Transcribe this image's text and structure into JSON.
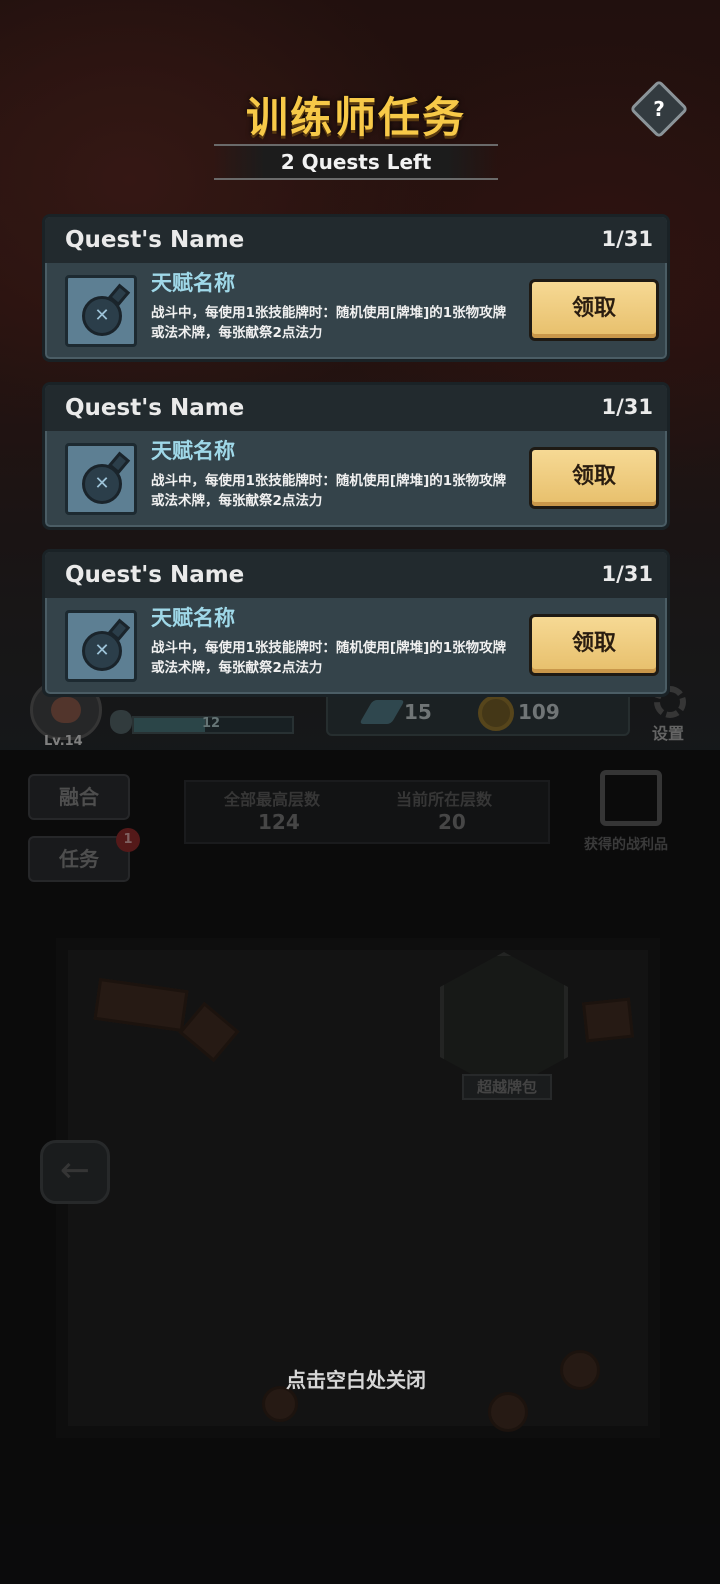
{
  "modal": {
    "title": "训练师任务",
    "subtitle": "2 Quests Left",
    "help_label": "?",
    "close_hint": "点击空白处关闭"
  },
  "quests": [
    {
      "name": "Quest's Name",
      "progress": "1/31",
      "talent_name": "天赋名称",
      "description": "战斗中，每使用1张技能牌时：随机使用[牌堆]的1张物攻牌或法术牌，每张献祭2点法力",
      "claim_label": "领取",
      "icon": "potion-bottle-icon"
    },
    {
      "name": "Quest's Name",
      "progress": "1/31",
      "talent_name": "天赋名称",
      "description": "战斗中，每使用1张技能牌时：随机使用[牌堆]的1张物攻牌或法术牌，每张献祭2点法力",
      "claim_label": "领取",
      "icon": "potion-bottle-icon"
    },
    {
      "name": "Quest's Name",
      "progress": "1/31",
      "talent_name": "天赋名称",
      "description": "战斗中，每使用1张技能牌时：随机使用[牌堆]的1张物攻牌或法术牌，每张献祭2点法力",
      "claim_label": "领取",
      "icon": "potion-bottle-icon"
    }
  ],
  "background": {
    "player_level": "Lv.14",
    "xp_value": "12",
    "xp_fraction": 0.45,
    "attack_value": "15",
    "coins_value": "109",
    "settings_label": "设置",
    "fusion_label": "融合",
    "task_label": "任务",
    "task_badge": "1",
    "best_floor_label": "全部最高层数",
    "best_floor_value": "124",
    "current_floor_label": "当前所在层数",
    "current_floor_value": "20",
    "loot_label": "获得的战利品",
    "pack_label": "超越牌包",
    "back_icon": "arrow-left-icon"
  },
  "colors": {
    "title_gold": "#f7c948",
    "talent_cyan": "#9fd8e8",
    "claim_button": "#f0cf85",
    "card_body": "#34434a",
    "card_header": "#222a2e"
  }
}
